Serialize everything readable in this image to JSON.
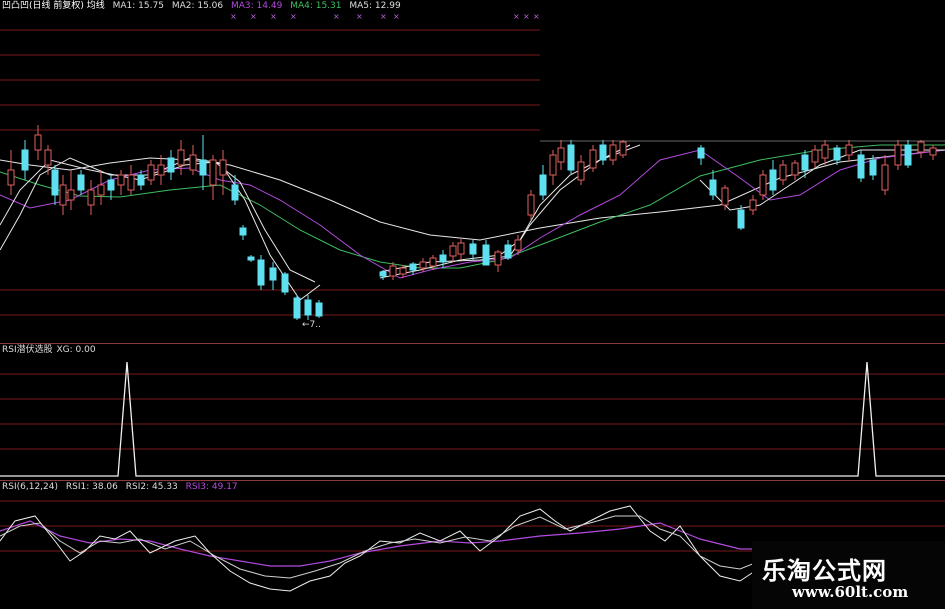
{
  "main_panel": {
    "title": "凹凸凹(日线 前复权) 均线",
    "ma": [
      {
        "label": "MA1: 15.75",
        "color": "#e8e8e8"
      },
      {
        "label": "MA2: 15.06",
        "color": "#e8e8e8"
      },
      {
        "label": "MA3: 14.49",
        "color": "#b44be0"
      },
      {
        "label": "MA4: 15.31",
        "color": "#3fbf5f"
      },
      {
        "label": "MA5: 12.99",
        "color": "#e8e8e8"
      }
    ],
    "low_marker": "←7.."
  },
  "xg_panel": {
    "title": "RSI潜伏选股",
    "value": "XG: 0.00"
  },
  "rsi_panel": {
    "title": "RSI(6,12,24)",
    "rsi1": "RSI1: 38.06",
    "rsi2": "RSI2: 45.33",
    "rsi3": "RSI3: 49.17",
    "rsi3_color": "#b44be0"
  },
  "watermark": {
    "title": "乐淘公式网",
    "url": "www.60lt.com"
  },
  "colors": {
    "up": "#e06060",
    "down": "#5fe0f0",
    "grid": "#7a1818",
    "divider": "#8a3a3a"
  }
}
